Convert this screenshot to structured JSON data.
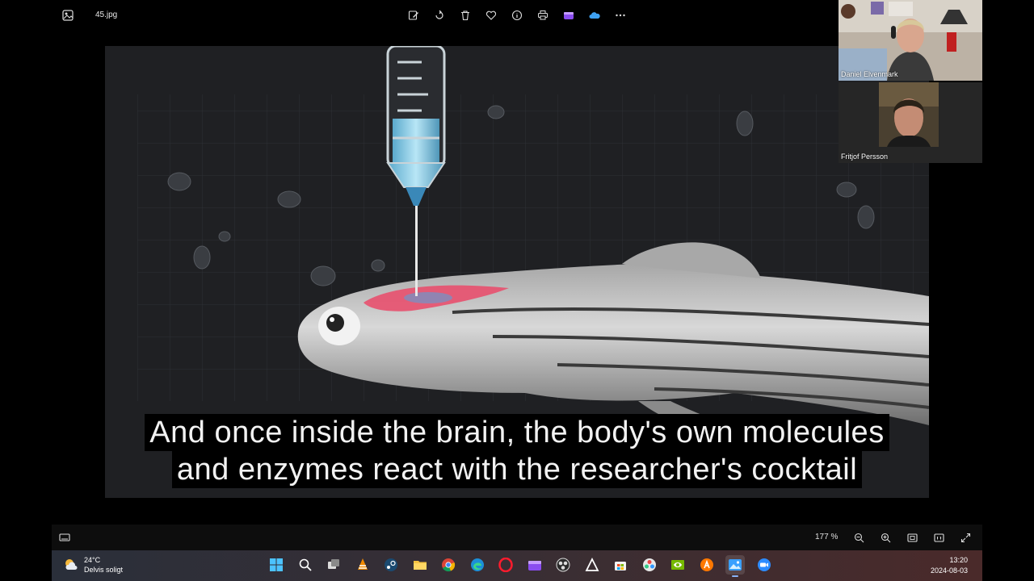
{
  "window": {
    "file_name": "45.jpg"
  },
  "toolbar": {
    "buttons": [
      "edit-image-icon",
      "rotate-icon",
      "delete-icon",
      "favorite-icon",
      "info-icon",
      "print-icon",
      "clipchamp-icon",
      "onedrive-icon",
      "more-icon"
    ]
  },
  "video": {
    "caption_line_1": "And once inside the brain, the body's own molecules",
    "caption_line_2": "and enzymes react with the researcher's cocktail"
  },
  "participants": [
    {
      "name": "Daniel Elvenmark"
    },
    {
      "name": "Fritjof Persson"
    }
  ],
  "statusbar": {
    "zoom_level": "177 %"
  },
  "taskbar": {
    "weather": {
      "temperature": "24°C",
      "condition": "Delvis soligt"
    },
    "apps": [
      "windows-start-icon",
      "search-icon",
      "task-view-icon",
      "vlc-icon",
      "steam-icon",
      "file-explorer-icon",
      "chrome-icon",
      "edge-icon",
      "opera-icon",
      "clipchamp-icon",
      "obs-icon",
      "unity-icon",
      "microsoft-store-icon",
      "davinci-resolve-icon",
      "nvidia-icon",
      "avast-icon",
      "photos-icon",
      "zoom-icon"
    ],
    "active_app": "photos-icon",
    "clock": {
      "time": "13:20",
      "date": "2024-08-03"
    }
  },
  "colors": {
    "accent": "#8ab4f8",
    "syringe": "#7ec8e8",
    "dye": "#e8506e"
  }
}
